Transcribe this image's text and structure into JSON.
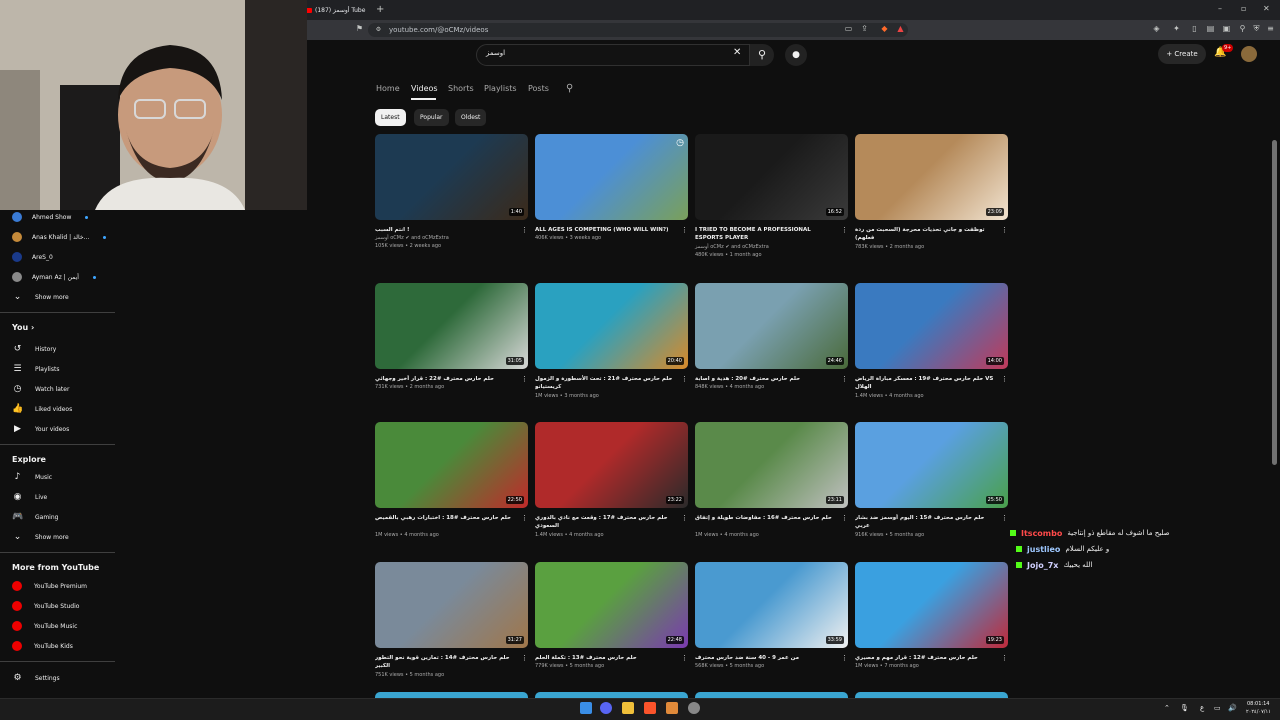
{
  "browser": {
    "tab_title": "أوسمز (187) Tube",
    "new_tab": "+",
    "url": "youtube.com/@oCMz/videos"
  },
  "header": {
    "search_value": "اوسمز",
    "create_label": "Create",
    "notif_badge": "9+"
  },
  "channel_tabs": [
    "Home",
    "Videos",
    "Shorts",
    "Playlists",
    "Posts"
  ],
  "chips": [
    "Latest",
    "Popular",
    "Oldest"
  ],
  "sidebar": {
    "subscriptions": [
      {
        "name": "Ahmed Show",
        "color": "#3a7bd5"
      },
      {
        "name": "Anas Khalid | خالد...",
        "color": "#c58a3a"
      },
      {
        "name": "AreS_0",
        "color": "#1a3a8a"
      },
      {
        "name": "Ayman Az | أيمن",
        "color": "#8a8a8a"
      }
    ],
    "show_more_1": "Show more",
    "you_label": "You",
    "you_items": [
      "History",
      "Playlists",
      "Watch later",
      "Liked videos",
      "Your videos"
    ],
    "explore_label": "Explore",
    "explore_items": [
      "Music",
      "Live",
      "Gaming",
      "Show more"
    ],
    "more_label": "More from YouTube",
    "more_items": [
      "YouTube Premium",
      "YouTube Studio",
      "YouTube Music",
      "YouTube Kids"
    ],
    "settings": "Settings"
  },
  "videos": [
    {
      "title": "انتم السبب !",
      "channel": "أوسمز oCMz ✔ and oCMzExtra",
      "meta": "105K views • 2 weeks ago",
      "duration": "1:40",
      "c1": "#1d3a52",
      "c2": "#3b2a1a"
    },
    {
      "title": "ALL AGES IS COMPETING (WHO WILL WIN?)",
      "channel": "",
      "meta": "406K views • 3 weeks ago",
      "duration": "",
      "c1": "#4c8fd6",
      "c2": "#7aa05a"
    },
    {
      "title": "I TRIED TO BECOME A PROFESSIONAL ESPORTS PLAYER",
      "channel": "أوسمز oCMz ✔ and oCMzExtra",
      "meta": "480K views • 1 month ago",
      "duration": "16:52",
      "c1": "#1a1a1a",
      "c2": "#3a3a3a"
    },
    {
      "title": "توظفت و جاني تحديات محرجة (السحبت من ردة فعلهم)",
      "channel": "",
      "meta": "783K views • 2 months ago",
      "duration": "23:09",
      "c1": "#b58a5a",
      "c2": "#f1e3d0"
    },
    {
      "title": "حلم حارس محترف #22 : قرار أخير وجهائي",
      "channel": "",
      "meta": "731K views • 2 months ago",
      "duration": "31:05",
      "c1": "#2e6a3a",
      "c2": "#d8d8d8"
    },
    {
      "title": "حلم حارس محترف #21 : تحت الأسطورة و الزمول كريستيانو",
      "channel": "",
      "meta": "1M views • 3 months ago",
      "duration": "20:40",
      "c1": "#2aa1c0",
      "c2": "#d88a2a"
    },
    {
      "title": "حلم حارس محترف #20 : هدية و اصابة",
      "channel": "",
      "meta": "848K views • 4 months ago",
      "duration": "24:46",
      "c1": "#7aa0b0",
      "c2": "#4a6a3a"
    },
    {
      "title": "حلم حارس محترف #19 : معسكر مباراة الرياض VS الهلال",
      "channel": "",
      "meta": "1.4M views • 4 months ago",
      "duration": "14:00",
      "c1": "#3a7ac0",
      "c2": "#c03a5a"
    },
    {
      "title": "حلم حارس محترف #18 : اختبارات رهبي بالقميص",
      "channel": "",
      "meta": "1M views • 4 months ago",
      "duration": "22:50",
      "c1": "#4a8a3a",
      "c2": "#c02a2a"
    },
    {
      "title": "حلم حارس محترف #17 : وقعت مع نادي بالدوري السعودي",
      "channel": "",
      "meta": "1.4M views • 4 months ago",
      "duration": "23:22",
      "c1": "#b02a2a",
      "c2": "#2a2a2a"
    },
    {
      "title": "حلم حارس محترف #16 : مفاوضات طويلة و إتفاق",
      "channel": "",
      "meta": "1M views • 4 months ago",
      "duration": "23:11",
      "c1": "#5a8a4a",
      "c2": "#c0c0c0"
    },
    {
      "title": "حلم حارس محترف #15 : اليوم أوسمز ضد بشار عربي",
      "channel": "",
      "meta": "916K views • 5 months ago",
      "duration": "25:50",
      "c1": "#5aa0e0",
      "c2": "#4aa04a"
    },
    {
      "title": "حلم حارس محترف #14 : تمارين قوية نحو التطور الكبير",
      "channel": "",
      "meta": "751K views • 5 months ago",
      "duration": "31:27",
      "c1": "#7a8a9a",
      "c2": "#a0764a"
    },
    {
      "title": "حلم حارس محترف #13 : تكملة الحلم",
      "channel": "",
      "meta": "779K views • 5 months ago",
      "duration": "22:48",
      "c1": "#5aa040",
      "c2": "#7a3ab0"
    },
    {
      "title": "من عمر 9 - 40 سنة ضد حارس محترف",
      "channel": "",
      "meta": "568K views • 5 months ago",
      "duration": "33:59",
      "c1": "#4a9ad0",
      "c2": "#f0f0f0"
    },
    {
      "title": "حلم حارس محترف #12 : قرار مهم و مصيري",
      "channel": "",
      "meta": "1M views • 7 months ago",
      "duration": "19:23",
      "c1": "#3aa0e0",
      "c2": "#c02a3a"
    }
  ],
  "chat": [
    {
      "user": "Itscombo",
      "msg": "صليح ما اشوف له مقاطع ذو إنتاجية",
      "color": "#ff4a4a"
    },
    {
      "user": "justlieo",
      "msg": "و عليكم السلام",
      "color": "#9ec8ff"
    },
    {
      "user": "Jojo_7x",
      "msg": "الله يحييك",
      "color": "#d0d0ff"
    }
  ],
  "taskbar": {
    "lang": "ع",
    "time": "08:01:14",
    "date": "٢٠٢٤/٠٧/١١"
  }
}
